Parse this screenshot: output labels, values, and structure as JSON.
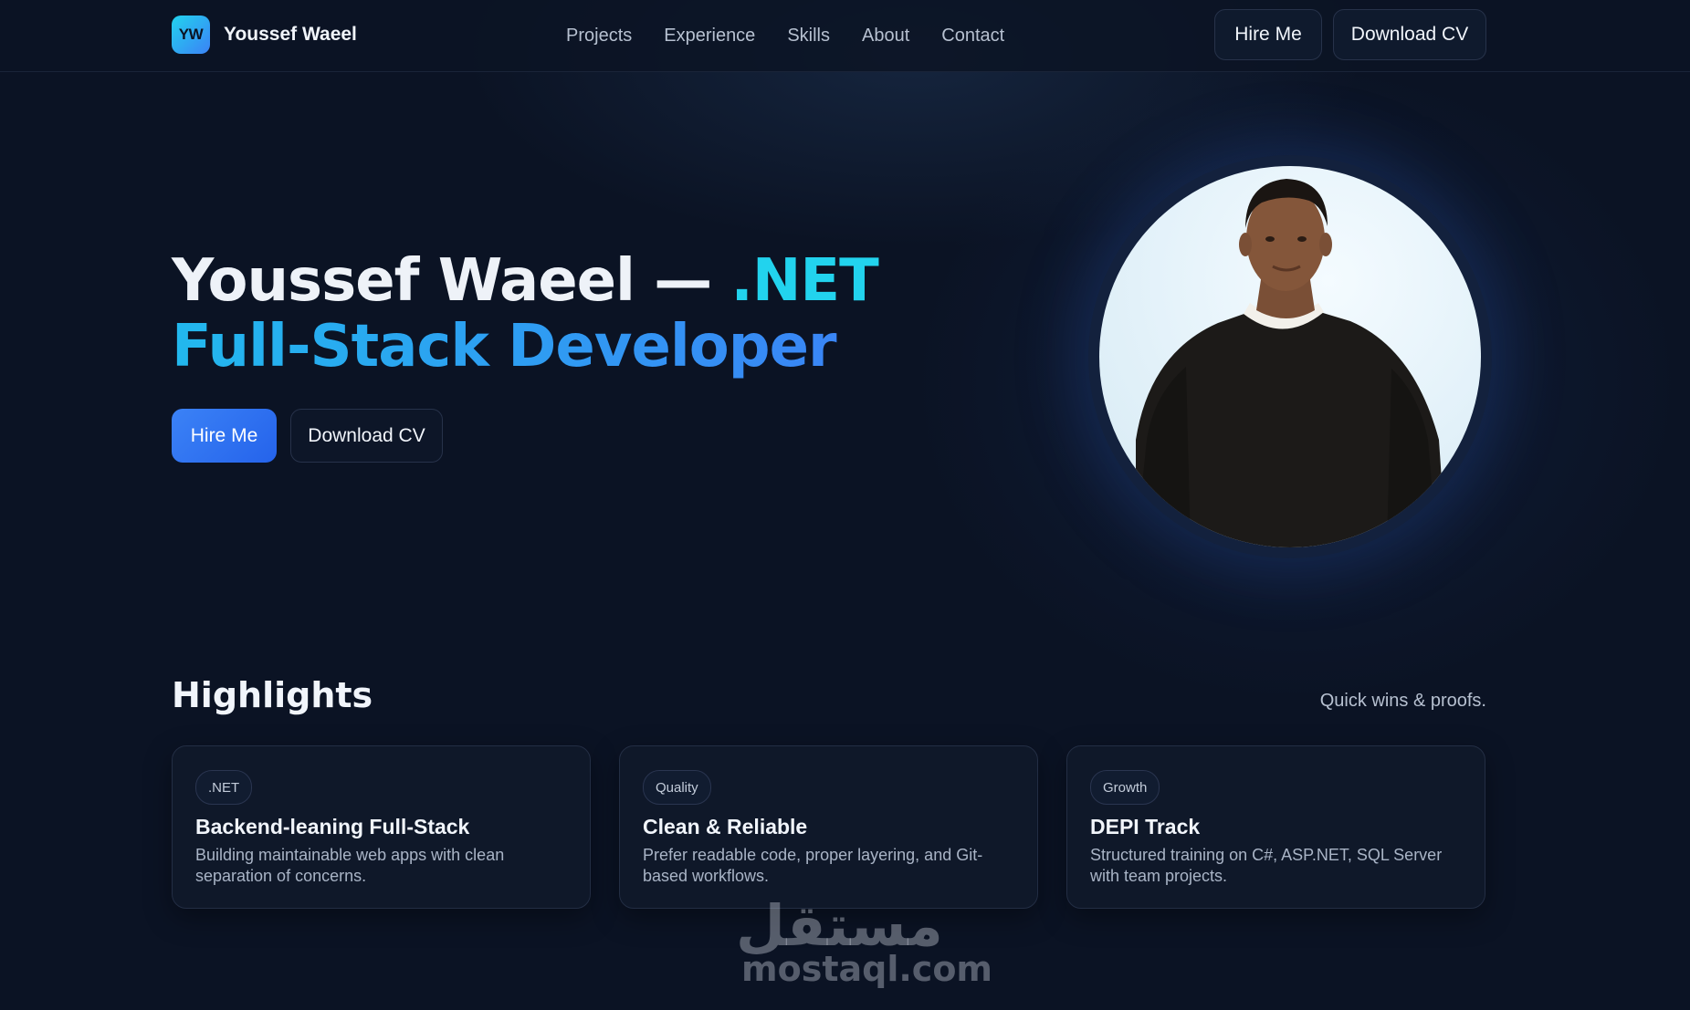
{
  "header": {
    "logo_text": "YW",
    "brand_name": "Youssef Waeel",
    "nav": [
      "Projects",
      "Experience",
      "Skills",
      "About",
      "Contact"
    ],
    "hire_label": "Hire Me",
    "cv_label": "Download CV"
  },
  "hero": {
    "title_name": "Youssef Waeel — ",
    "title_accent": ".NET",
    "title_line2": "Full-Stack Developer",
    "hire_label": "Hire Me",
    "cv_label": "Download CV"
  },
  "highlights": {
    "title": "Highlights",
    "subtitle": "Quick wins & proofs.",
    "cards": [
      {
        "tag": ".NET",
        "title": "Backend-leaning Full-Stack",
        "text": "Building maintainable web apps with clean separation of concerns."
      },
      {
        "tag": "Quality",
        "title": "Clean & Reliable",
        "text": "Prefer readable code, proper layering, and Git-based workflows."
      },
      {
        "tag": "Growth",
        "title": "DEPI Track",
        "text": "Structured training on C#, ASP.NET, SQL Server with team projects."
      }
    ]
  },
  "watermark": {
    "arabic": "مستقل",
    "latin": "mostaql.com"
  },
  "colors": {
    "background": "#0b1324",
    "accent_cyan": "#22d3ee",
    "accent_blue": "#3b82f6"
  }
}
